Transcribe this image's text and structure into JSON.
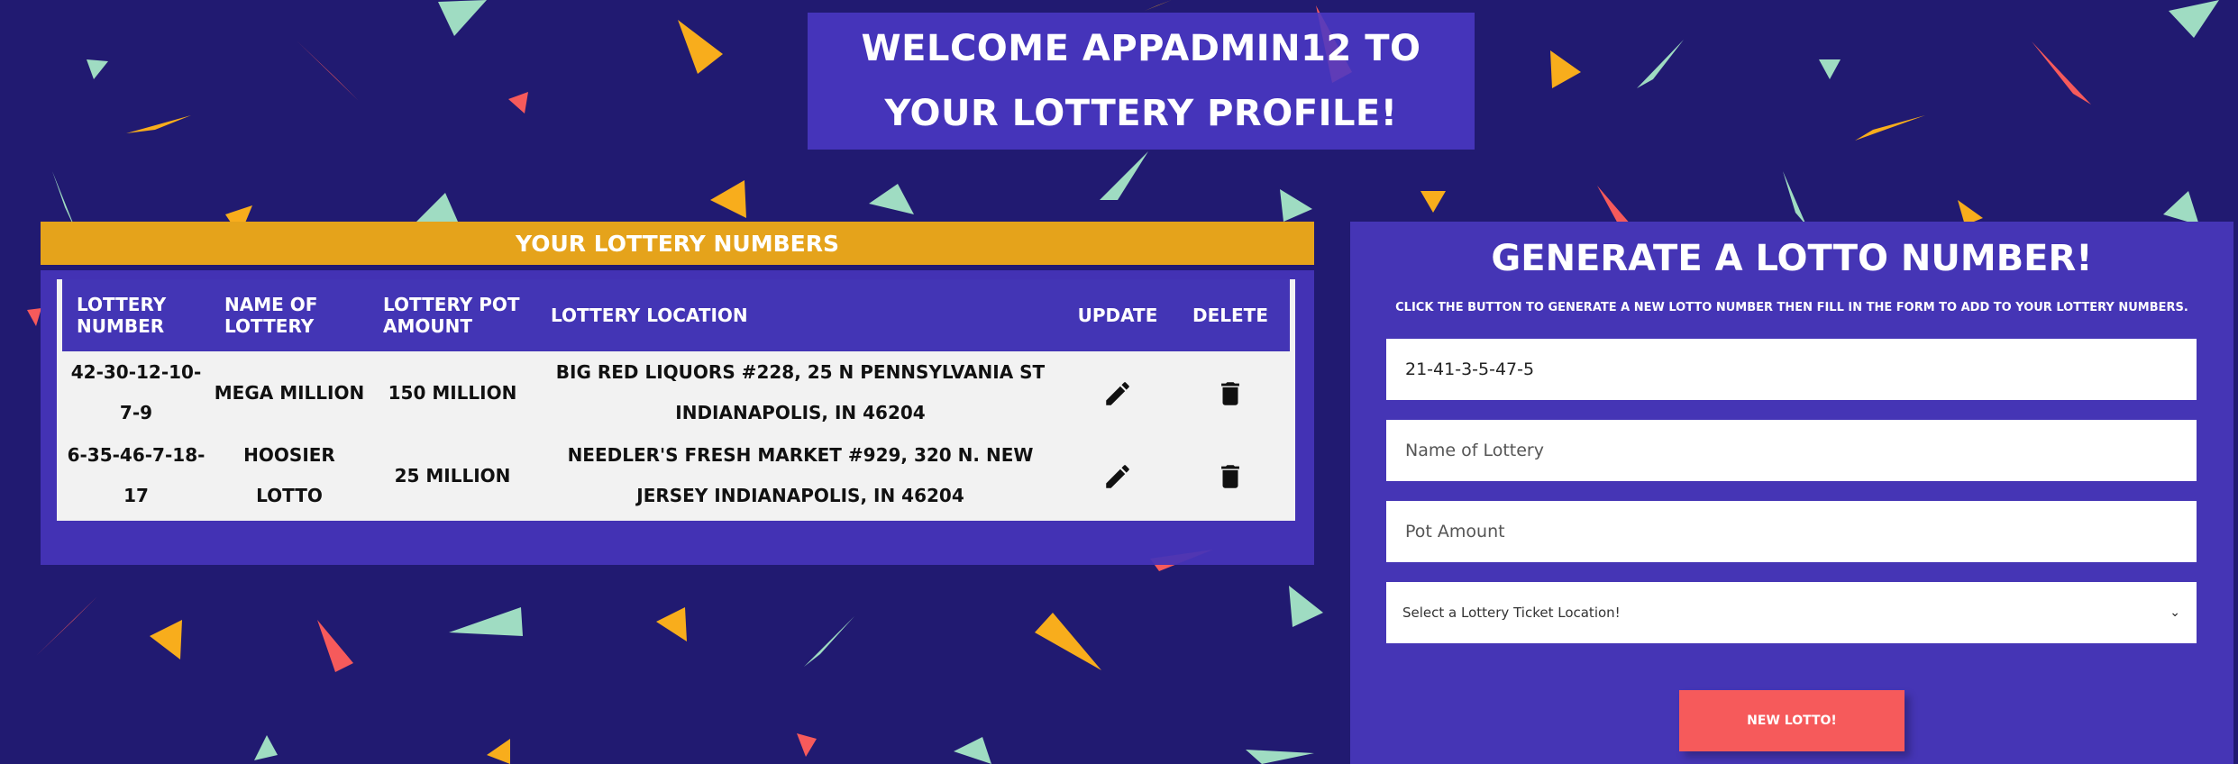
{
  "header": {
    "welcome_text": "WELCOME APPADMIN12 TO YOUR LOTTERY PROFILE!"
  },
  "numbers_panel": {
    "title": "YOUR LOTTERY NUMBERS",
    "columns": [
      "LOTTERY NUMBER",
      "NAME OF LOTTERY",
      "LOTTERY POT AMOUNT",
      "LOTTERY LOCATION",
      "UPDATE",
      "DELETE"
    ],
    "rows": [
      {
        "number": "42-30-12-10-7-9",
        "name": "MEGA MILLION",
        "pot": "150 MILLION",
        "location": "BIG RED LIQUORS #228, 25 N PENNSYLVANIA ST INDIANAPOLIS, IN 46204"
      },
      {
        "number": "6-35-46-7-18-17",
        "name": "HOOSIER LOTTO",
        "pot": "25 MILLION",
        "location": "NEEDLER'S FRESH MARKET #929, 320 N. NEW JERSEY INDIANAPOLIS, IN 46204"
      }
    ],
    "update_icon": "pencil-icon",
    "delete_icon": "trash-icon"
  },
  "generator": {
    "title": "GENERATE A LOTTO NUMBER!",
    "subtitle": "CLICK THE BUTTON TO GENERATE A NEW LOTTO NUMBER THEN FILL IN THE FORM TO ADD TO YOUR LOTTERY NUMBERS.",
    "number_value": "21-41-3-5-47-5",
    "name_placeholder": "Name of Lottery",
    "pot_placeholder": "Pot Amount",
    "location_selected": "Select a Lottery Ticket Location!",
    "button_label": "NEW LOTTO!"
  },
  "colors": {
    "background": "#211a71",
    "panel": "#4535b5",
    "accent_gold": "#e5a31b",
    "button_red": "#f65a5b",
    "confetti": [
      "#f65a5b",
      "#f8ad1c",
      "#9fdcc2"
    ]
  }
}
